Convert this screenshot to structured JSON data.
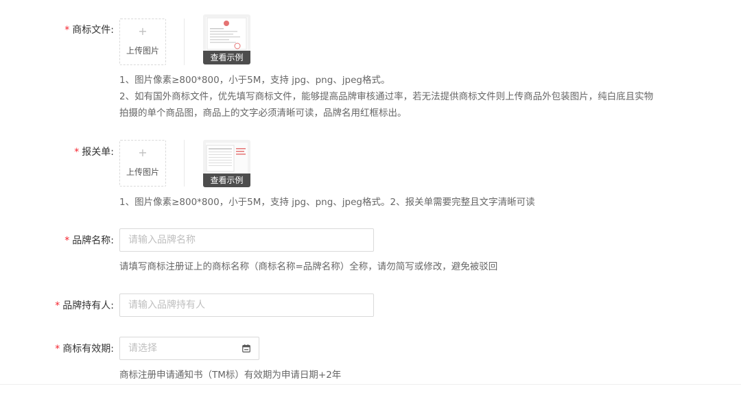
{
  "trademark_file": {
    "label": "商标文件:",
    "upload_label": "上传图片",
    "example_label": "查看示例",
    "hint_lines": [
      "1、图片像素≥800*800，小于5M，支持 jpg、png、jpeg格式。",
      "2、如有国外商标文件，优先填写商标文件，能够提高品牌审核通过率，若无法提供商标文件则上传商品外包装图片，纯白底且实物",
      "拍摄的单个商品图，商品上的文字必须清晰可读，品牌名用红框标出。"
    ]
  },
  "customs_form": {
    "label": "报关单:",
    "upload_label": "上传图片",
    "example_label": "查看示例",
    "hint": "1、图片像素≥800*800，小于5M，支持 jpg、png、jpeg格式。2、报关单需要完整且文字清晰可读"
  },
  "brand_name": {
    "label": "品牌名称:",
    "placeholder": "请输入品牌名称",
    "value": "",
    "hint": "请填写商标注册证上的商标名称（商标名称=品牌名称）全称，请勿简写或修改，避免被驳回"
  },
  "brand_holder": {
    "label": "品牌持有人:",
    "placeholder": "请输入品牌持有人",
    "value": ""
  },
  "trademark_validity": {
    "label": "商标有效期:",
    "placeholder": "请选择",
    "icon": "calendar-icon",
    "hint": "商标注册申请通知书（TM标）有效期为申请日期+2年"
  },
  "colors": {
    "required_mark": "#f5222d",
    "placeholder": "#bfbfbf",
    "border": "#d9d9d9"
  }
}
